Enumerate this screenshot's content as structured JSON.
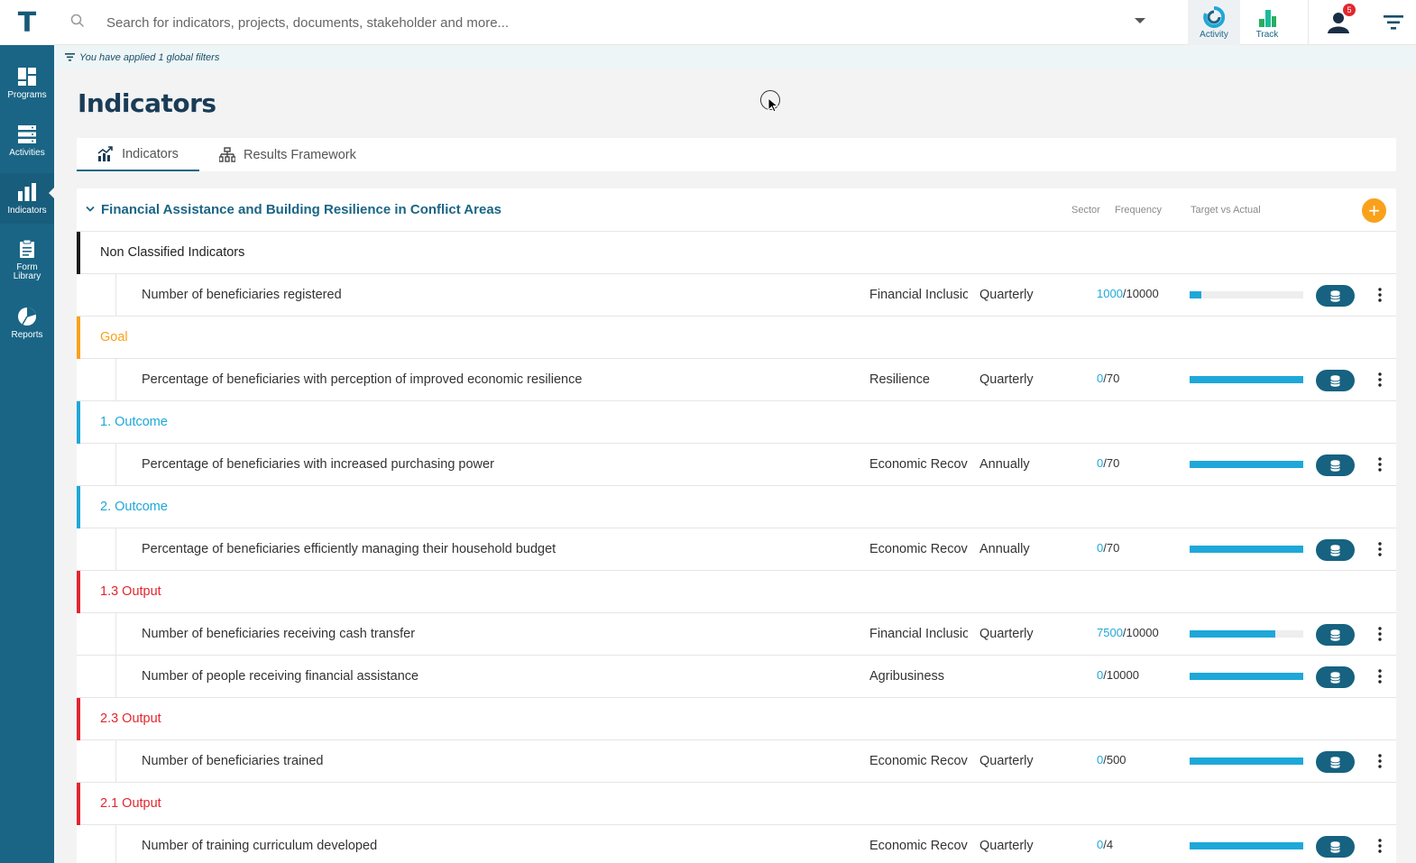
{
  "app": {
    "logo_letter": "T"
  },
  "sidebar": {
    "items": [
      {
        "label": "Programs",
        "icon": "dashboard-icon"
      },
      {
        "label": "Activities",
        "icon": "server-icon"
      },
      {
        "label": "Indicators",
        "icon": "bar-chart-icon",
        "active": true
      },
      {
        "label": "Form Library",
        "icon": "clipboard-icon"
      },
      {
        "label": "Reports",
        "icon": "pie-chart-icon"
      }
    ]
  },
  "topbar": {
    "search_placeholder": "Search for indicators, projects, documents, stakeholder and more...",
    "activity_label": "Activity",
    "track_label": "Track",
    "notification_count": "5"
  },
  "filter_notice": "You have applied 1 global filters",
  "page_title": "Indicators",
  "tabs": [
    {
      "label": "Indicators",
      "active": true
    },
    {
      "label": "Results Framework",
      "active": false
    }
  ],
  "program": {
    "title": "Financial Assistance and Building Resilience in Conflict Areas",
    "columns": {
      "sector": "Sector",
      "frequency": "Frequency",
      "target_vs_actual": "Target vs Actual"
    },
    "add_symbol": "+"
  },
  "colors": {
    "brand": "#1a6585",
    "accent_orange": "#f9a11b",
    "progress": "#1ea8d9",
    "group_non_classified": "#1a1a1a",
    "group_goal": "#f9a11b",
    "group_outcome": "#1ea8d9",
    "group_output": "#e3262f"
  },
  "groups": [
    {
      "label": "Non Classified Indicators",
      "color": "#1a1a1a",
      "text_color": "#222222",
      "indicators": [
        {
          "name": "Number of beneficiaries registered",
          "sector": "Financial Inclusion",
          "frequency": "Quarterly",
          "actual": "1000",
          "target": "/10000",
          "progress": 0.1
        }
      ]
    },
    {
      "label": "Goal",
      "color": "#f9a11b",
      "text_color": "#f9a11b",
      "indicators": [
        {
          "name": "Percentage of beneficiaries with perception of improved economic resilience",
          "sector": "Resilience",
          "frequency": "Quarterly",
          "actual": "0",
          "target": "/70",
          "progress": 1.0
        }
      ]
    },
    {
      "label": "1. Outcome",
      "color": "#1ea8d9",
      "text_color": "#1ea8d9",
      "indicators": [
        {
          "name": "Percentage of beneficiaries with increased purchasing power",
          "sector": "Economic Recovery",
          "frequency": "Annually",
          "actual": "0",
          "target": "/70",
          "progress": 1.0
        }
      ]
    },
    {
      "label": "2. Outcome",
      "color": "#1ea8d9",
      "text_color": "#1ea8d9",
      "indicators": [
        {
          "name": "Percentage of beneficiaries efficiently managing their household budget",
          "sector": "Economic Recovery",
          "frequency": "Annually",
          "actual": "0",
          "target": "/70",
          "progress": 1.0
        }
      ]
    },
    {
      "label": "1.3 Output",
      "color": "#e3262f",
      "text_color": "#e3262f",
      "indicators": [
        {
          "name": "Number of beneficiaries receiving cash transfer",
          "sector": "Financial Inclusion",
          "frequency": "Quarterly",
          "actual": "7500",
          "target": "/10000",
          "progress": 0.75
        },
        {
          "name": "Number of people receiving financial assistance",
          "sector": "Agribusiness",
          "frequency": "",
          "actual": "0",
          "target": "/10000",
          "progress": 1.0
        }
      ]
    },
    {
      "label": "2.3 Output",
      "color": "#e3262f",
      "text_color": "#e3262f",
      "indicators": [
        {
          "name": "Number of beneficiaries trained",
          "sector": "Economic Recovery",
          "frequency": "Quarterly",
          "actual": "0",
          "target": "/500",
          "progress": 1.0
        }
      ]
    },
    {
      "label": "2.1 Output",
      "color": "#e3262f",
      "text_color": "#e3262f",
      "indicators": [
        {
          "name": "Number of training curriculum developed",
          "sector": "Economic Recovery",
          "frequency": "Quarterly",
          "actual": "0",
          "target": "/4",
          "progress": 1.0
        }
      ]
    }
  ]
}
